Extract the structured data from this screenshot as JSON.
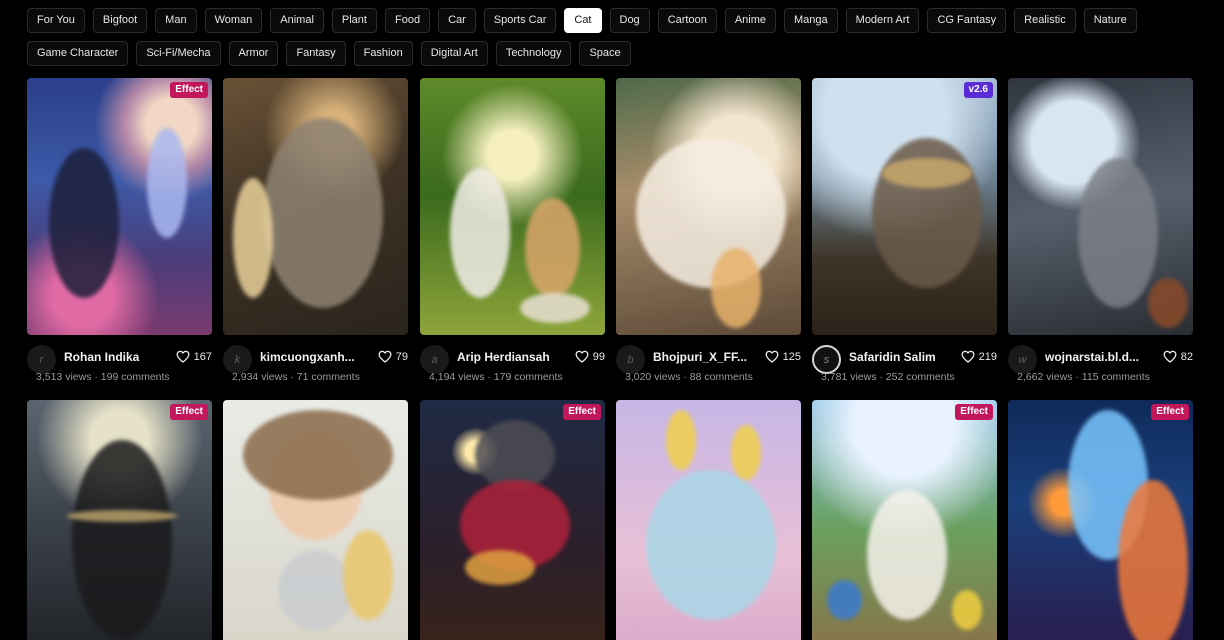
{
  "categories": {
    "row1": [
      "For You",
      "Bigfoot",
      "Man",
      "Woman",
      "Animal",
      "Plant",
      "Food",
      "Car",
      "Sports Car",
      "Cat",
      "Dog",
      "Cartoon",
      "Anime",
      "Manga",
      "Modern Art",
      "CG Fantasy",
      "Realistic",
      "Nature"
    ],
    "row2": [
      "Game Character",
      "Sci-Fi/Mecha",
      "Armor",
      "Fantasy",
      "Fashion",
      "Digital Art",
      "Technology",
      "Space"
    ],
    "active": "Cat"
  },
  "cards": [
    {
      "author": "Rohan Indika",
      "avatar_letter": "r",
      "likes": "167",
      "views": "3,513 views",
      "comments": "199 comments",
      "badge": "Effect",
      "icon": "heart-icon"
    },
    {
      "author": "kimcuongxanh...",
      "avatar_letter": "k",
      "likes": "79",
      "views": "2,934 views",
      "comments": "71 comments",
      "badge": "",
      "icon": "heart-icon"
    },
    {
      "author": "Arip Herdiansah",
      "avatar_letter": "a",
      "likes": "99",
      "views": "4,194 views",
      "comments": "179 comments",
      "badge": "",
      "icon": "heart-icon"
    },
    {
      "author": "Bhojpuri_X_FF...",
      "avatar_letter": "b",
      "likes": "125",
      "views": "3,020 views",
      "comments": "88 comments",
      "badge": "",
      "icon": "heart-icon"
    },
    {
      "author": "Safaridin Salim",
      "avatar_letter": "s",
      "likes": "219",
      "views": "3,781 views",
      "comments": "252 comments",
      "badge": "v2.6",
      "icon": "heart-icon"
    },
    {
      "author": "wojnarstai.bl.d...",
      "avatar_letter": "w",
      "likes": "82",
      "views": "2,662 views",
      "comments": "115 comments",
      "badge": "",
      "icon": "heart-icon"
    },
    {
      "badge": "Effect"
    },
    {
      "badge": ""
    },
    {
      "badge": "Effect"
    },
    {
      "badge": ""
    },
    {
      "badge": "Effect"
    },
    {
      "badge": "Effect"
    }
  ],
  "colors": {
    "effect_badge": "#c2185b",
    "version_badge": "#5b2bd6",
    "active_chip": "#ffffff"
  }
}
